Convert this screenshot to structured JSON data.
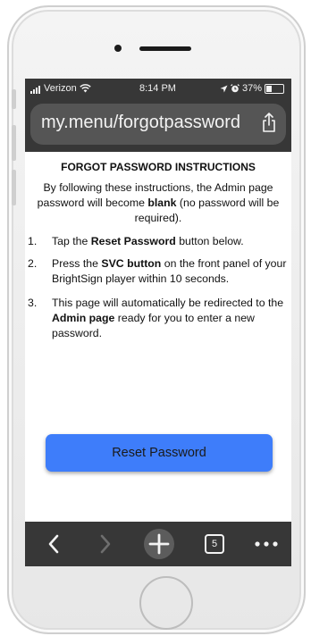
{
  "status": {
    "carrier": "Verizon",
    "time": "8:14 PM",
    "battery": "37%",
    "battery_level": 0.37
  },
  "browser": {
    "url": "my.menu/forgotpassword",
    "tabs_count": "5"
  },
  "page": {
    "title": "FORGOT PASSWORD INSTRUCTIONS",
    "intro_pre": "By following these instructions, the Admin page password will become ",
    "intro_bold": "blank",
    "intro_post": " (no password will be required).",
    "steps": [
      {
        "num": "1.",
        "pre": "Tap the ",
        "bold": "Reset Password",
        "post": " button below."
      },
      {
        "num": "2.",
        "pre": "Press the ",
        "bold": "SVC button",
        "post": " on the front panel of your BrightSign player within 10 seconds."
      },
      {
        "num": "3.",
        "pre": "This page will automatically be redirected to the ",
        "bold": "Admin page",
        "post": " ready for you to enter a new password."
      }
    ],
    "reset_button": "Reset Password"
  },
  "colors": {
    "button": "#3e7dfa",
    "browser_chrome": "#373737",
    "url_field": "#555555"
  }
}
